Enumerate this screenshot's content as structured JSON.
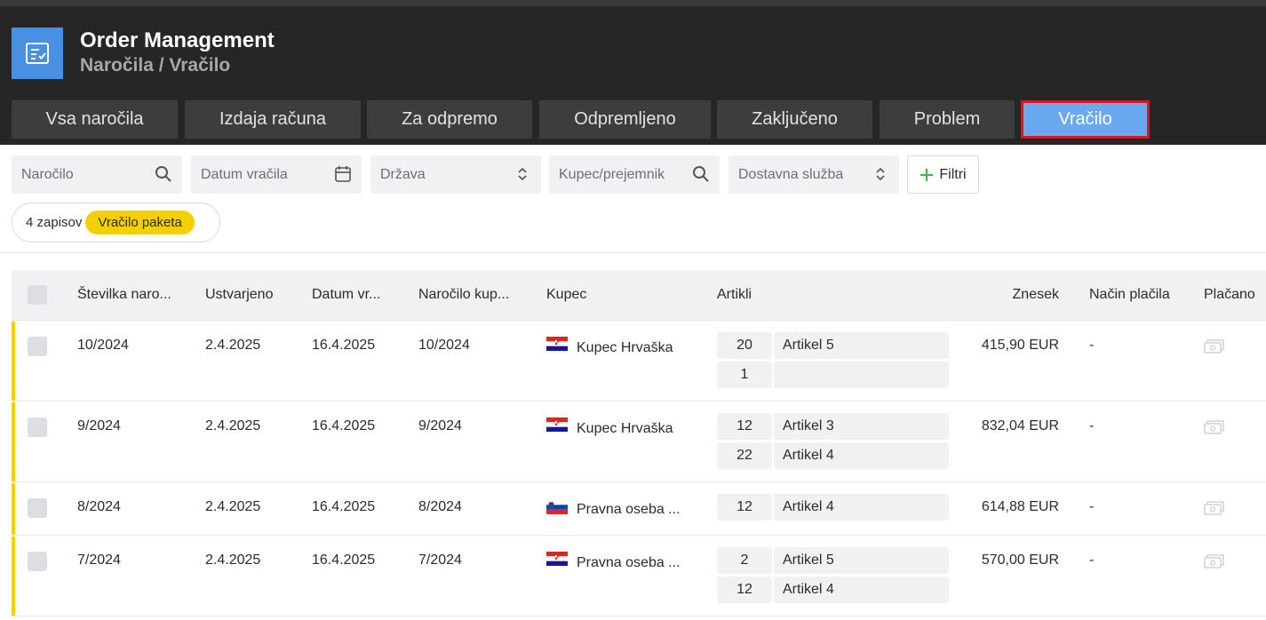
{
  "app": {
    "title": "Order Management",
    "breadcrumb": "Naročila / Vračilo"
  },
  "tabs": [
    {
      "label": "Vsa naročila",
      "active": false
    },
    {
      "label": "Izdaja računa",
      "active": false
    },
    {
      "label": "Za odpremo",
      "active": false
    },
    {
      "label": "Odpremljeno",
      "active": false
    },
    {
      "label": "Zaključeno",
      "active": false
    },
    {
      "label": "Problem",
      "active": false
    },
    {
      "label": "Vračilo",
      "active": true
    }
  ],
  "filters": {
    "order": {
      "placeholder": "Naročilo",
      "icon": "search-icon"
    },
    "return_date": {
      "placeholder": "Datum vračila",
      "icon": "calendar-icon"
    },
    "country": {
      "placeholder": "Država",
      "icon": "select-arrows-icon"
    },
    "customer": {
      "placeholder": "Kupec/prejemnik",
      "icon": "search-icon"
    },
    "delivery": {
      "placeholder": "Dostavna služba",
      "icon": "select-arrows-icon"
    },
    "more_label": "Filtri"
  },
  "summary": {
    "count": "4 zapisov",
    "badge": "Vračilo paketa"
  },
  "table": {
    "headers": {
      "number": "Številka naro...",
      "created": "Ustvarjeno",
      "date": "Datum vr...",
      "order_customer": "Naročilo kup...",
      "customer": "Kupec",
      "items": "Artikli",
      "amount": "Znesek",
      "payment": "Način plačila",
      "paid": "Plačano"
    },
    "rows": [
      {
        "number": "10/2024",
        "created": "2.4.2025",
        "date": "16.4.2025",
        "order_customer": "10/2024",
        "flag": "hr",
        "customer": "Kupec Hrvaška",
        "items": [
          {
            "qty": "20",
            "name": "Artikel 5"
          },
          {
            "qty": "1",
            "name": ""
          }
        ],
        "amount": "415,90 EUR",
        "payment": "-"
      },
      {
        "number": "9/2024",
        "created": "2.4.2025",
        "date": "16.4.2025",
        "order_customer": "9/2024",
        "flag": "hr",
        "customer": "Kupec Hrvaška",
        "items": [
          {
            "qty": "12",
            "name": "Artikel 3"
          },
          {
            "qty": "22",
            "name": "Artikel 4"
          }
        ],
        "amount": "832,04 EUR",
        "payment": "-"
      },
      {
        "number": "8/2024",
        "created": "2.4.2025",
        "date": "16.4.2025",
        "order_customer": "8/2024",
        "flag": "si",
        "customer": "Pravna oseba ...",
        "items": [
          {
            "qty": "12",
            "name": "Artikel 4"
          }
        ],
        "amount": "614,88 EUR",
        "payment": "-"
      },
      {
        "number": "7/2024",
        "created": "2.4.2025",
        "date": "16.4.2025",
        "order_customer": "7/2024",
        "flag": "hr",
        "customer": "Pravna oseba ...",
        "items": [
          {
            "qty": "2",
            "name": "Artikel 5"
          },
          {
            "qty": "12",
            "name": "Artikel 4"
          }
        ],
        "amount": "570,00 EUR",
        "payment": "-"
      }
    ]
  },
  "colors": {
    "accent": "#6aa9f0",
    "highlight": "#e0141c",
    "badge": "#f5d000",
    "header_bg": "#262626"
  }
}
